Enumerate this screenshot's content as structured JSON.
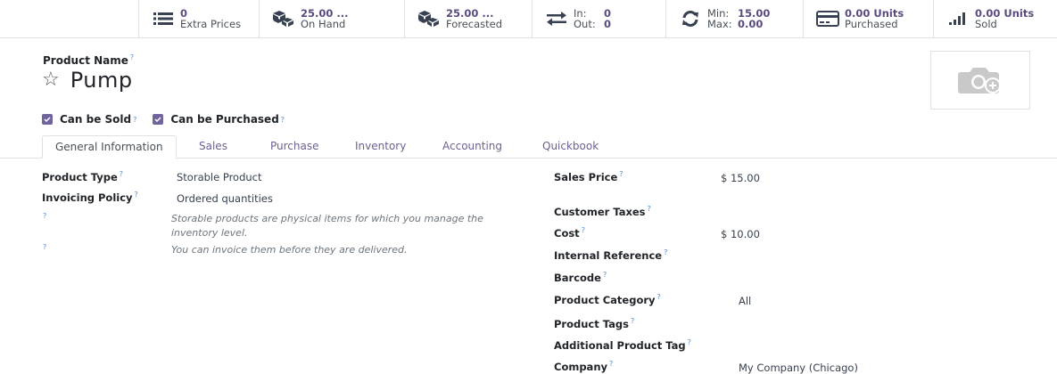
{
  "smart_buttons": [
    {
      "value": "0",
      "label": "Extra Prices",
      "icon": "list-icon"
    },
    {
      "value": "25.00 ...",
      "label": "On Hand",
      "icon": "cubes-icon"
    },
    {
      "value": "25.00 ...",
      "label": "Forecasted",
      "icon": "cubes-icon"
    },
    {
      "in_label": "In:",
      "in_value": "0",
      "out_label": "Out:",
      "out_value": "0",
      "icon": "exchange-icon"
    },
    {
      "min_label": "Min:",
      "min_value": "15.00",
      "max_label": "Max:",
      "max_value": "0.00",
      "icon": "refresh-icon"
    },
    {
      "value": "0.00 Units",
      "label": "Purchased",
      "icon": "credit-card-icon"
    },
    {
      "value": "0.00 Units",
      "label": "Sold",
      "icon": "signal-icon"
    }
  ],
  "product": {
    "name_label": "Product Name",
    "name": "Pump",
    "help_mark": "?"
  },
  "checkboxes": [
    {
      "label": "Can be Sold",
      "checked": true
    },
    {
      "label": "Can be Purchased",
      "checked": true
    }
  ],
  "tabs": [
    "General Information",
    "Sales",
    "Purchase",
    "Inventory",
    "Accounting",
    "Quickbook"
  ],
  "left_fields": {
    "product_type_label": "Product Type",
    "product_type_value": "Storable Product",
    "invoicing_policy_label": "Invoicing Policy",
    "invoicing_policy_value": "Ordered quantities",
    "note1": "Storable products are physical items for which you manage the inventory level.",
    "note2": "You can invoice them before they are delivered."
  },
  "right_fields": {
    "sales_price_label": "Sales Price",
    "sales_price_value": "$ 15.00",
    "customer_taxes_label": "Customer Taxes",
    "cost_label": "Cost",
    "cost_value": "$ 10.00",
    "internal_reference_label": "Internal Reference",
    "barcode_label": "Barcode",
    "product_category_label": "Product Category",
    "product_category_value": "All",
    "product_tags_label": "Product Tags",
    "additional_tag_label": "Additional Product Tag",
    "company_label": "Company",
    "company_value": "My Company (Chicago)"
  },
  "colors": {
    "accent": "#71639e",
    "help": "#4f8dd3",
    "border": "#dee2e6"
  }
}
